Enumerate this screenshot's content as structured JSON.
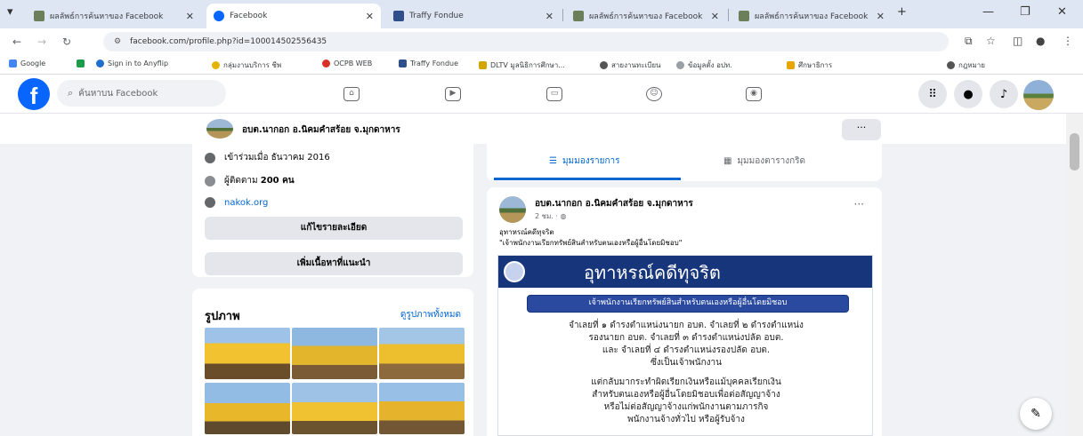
{
  "browser": {
    "tabs": [
      {
        "title": "ผลลัพธ์การค้นหาของ Facebook",
        "active": false
      },
      {
        "title": "Facebook",
        "active": true
      },
      {
        "title": "Traffy Fondue",
        "active": false
      },
      {
        "title": "ผลลัพธ์การค้นหาของ Facebook",
        "active": false
      },
      {
        "title": "ผลลัพธ์การค้นหาของ Facebook",
        "active": false
      }
    ],
    "new_tab": "+",
    "minimize": "—",
    "restore": "❐",
    "close": "✕",
    "url": "facebook.com/profile.php?id=100014502556435",
    "bookmarks": [
      "Google",
      "Sign in to Anyflip",
      "กลุ่มงานบริการ ชีพ",
      "OCPB WEB",
      "Traffy Fondue",
      "DLTV มูลนิธิการศึกษา...",
      "สายงานทะเบียน",
      "ข้อมูลตั้ง อปท.",
      "ศึกษาธิการ",
      "กฎหมาย"
    ]
  },
  "fb": {
    "logo": "f",
    "search_placeholder": "ค้นหาบน Facebook"
  },
  "profile": {
    "name": "อบต.นากอก อ.นิคมคำสร้อย จ.มุกดาหาร",
    "more": "···"
  },
  "intro": {
    "joined": "เข้าร่วมเมื่อ ธันวาคม 2016",
    "followers_label": "ผู้ติดตาม",
    "followers": "200 คน",
    "website": "nakok.org",
    "edit_details": "แก้ไขรายละเอียด",
    "add_featured": "เพิ่มเนื้อหาที่แนะนำ"
  },
  "photos": {
    "title": "รูปภาพ",
    "see_all": "ดูรูปภาพทั้งหมด"
  },
  "post_tabs": {
    "list": "มุมมองรายการ",
    "grid": "มุมมองตารางกริด"
  },
  "post": {
    "author": "อบต.นากอก อ.นิคมคำสร้อย จ.มุกดาหาร",
    "time": "2 ชม.",
    "more": "···",
    "line1": "อุทาหรณ์คดีทุจริต",
    "line2": "\"เจ้าพนักงานเรียกทรัพย์สินสำหรับตนเองหรือผู้อื่นโดยมิชอบ\"",
    "poster_title": "อุทาหรณ์คดีทุจริต",
    "poster_sub": "เจ้าพนักงานเรียกทรัพย์สินสำหรับตนเองหรือผู้อื่นโดยมิชอบ",
    "poster_body": [
      "จำเลยที่ ๑ ดำรงตำแหน่งนายก อบต. จำเลยที่ ๒ ดำรงตำแหน่ง",
      "รองนายก อบต. จำเลยที่ ๓ ดำรงตำแหน่งปลัด อบต.",
      "และ จำเลยที่ ๔ ดำรงตำแหน่งรองปลัด อบต.",
      "ซึ่งเป็นเจ้าพนักงาน",
      "แต่กลับมากระทำผิดเรียกเงินหรือแม้บุคคลเรียกเงิน",
      "สำหรับตนเองหรือผู้อื่นโดยมิชอบเพื่อต่อสัญญาจ้าง",
      "หรือไม่ต่อสัญญาจ้างแก่พนักงานตามภารกิจ",
      "พนักงานจ้างทั่วไป หรือผู้รับจ้าง"
    ]
  }
}
